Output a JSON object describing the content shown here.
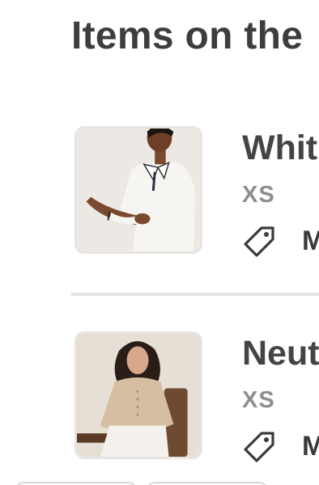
{
  "header": {
    "title": "Items on the"
  },
  "items": [
    {
      "name": "Whit",
      "size": "XS",
      "price_label": "M",
      "image_icon": "product-photo-white-knit-polo"
    },
    {
      "name": "Neut",
      "size": "XS",
      "price_label": "M",
      "image_icon": "product-photo-neutral-cardigan"
    }
  ],
  "colors": {
    "title_text": "#3d3d3d",
    "size_text": "#8e8e8e",
    "divider": "#e6e4e2",
    "thumb_border": "#e7e4e1"
  }
}
